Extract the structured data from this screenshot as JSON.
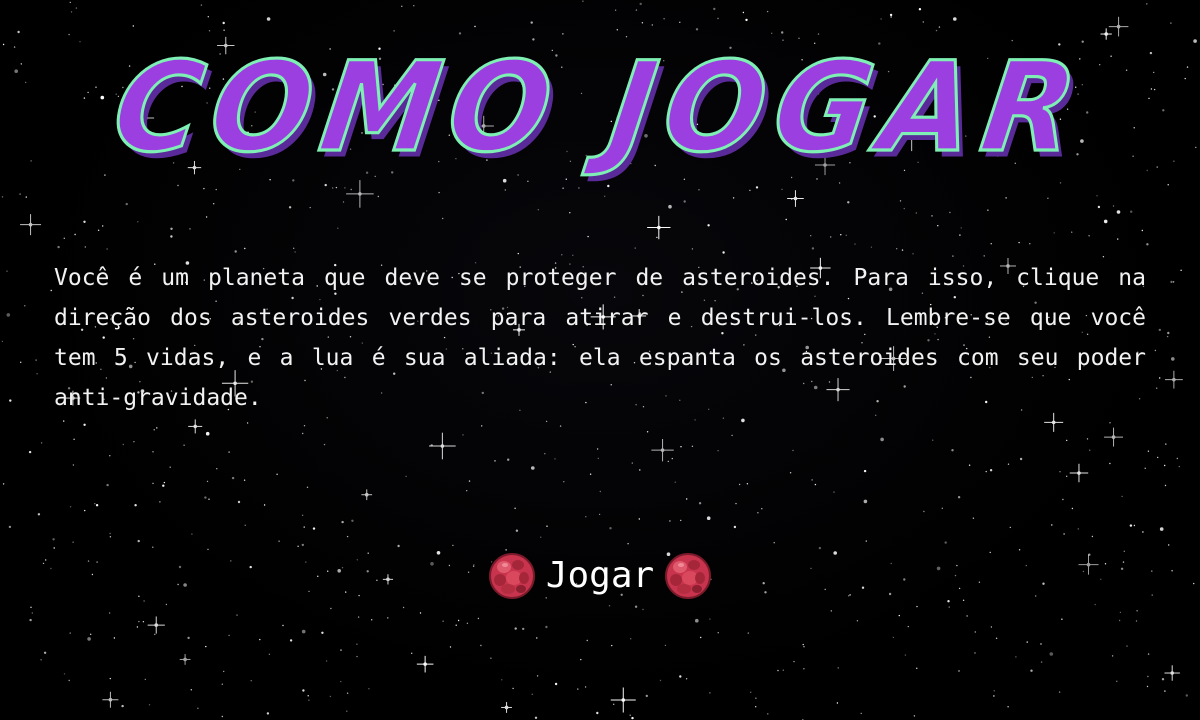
{
  "screen": {
    "title": "COMO JOGAR",
    "description": "Você é um planeta que deve se proteger de asteroides. Para isso, clique na direção dos asteroides verdes para atirar e destrui-los. Lembre-se que você tem 5 vidas, e a lua é sua aliada: ela espanta os asteroides com seu poder anti-gravidade.",
    "play_label": "Jogar"
  },
  "colors": {
    "title_fill": "#9b3fe0",
    "title_outline": "#7ef0b4",
    "title_shadow": "#5b2a9a",
    "text": "#f2f2f2",
    "background": "#000000",
    "asteroid_icon": "#c8344d"
  },
  "icons": {
    "play_left": "red-asteroid-icon",
    "play_right": "red-asteroid-icon"
  }
}
